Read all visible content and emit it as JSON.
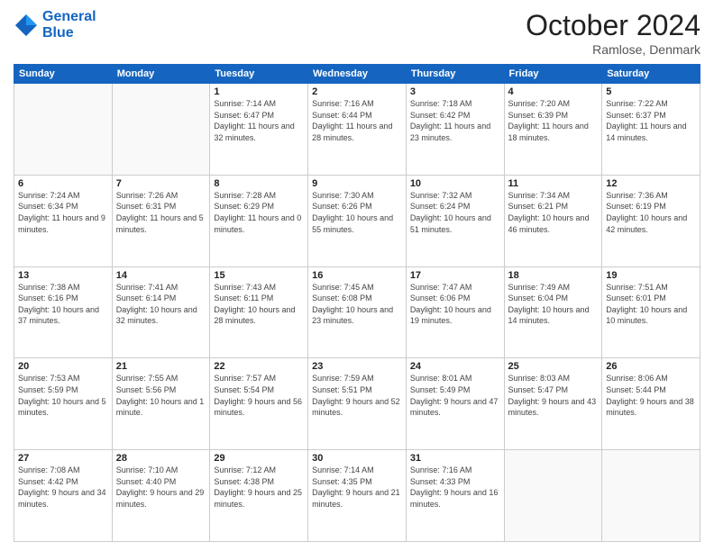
{
  "header": {
    "logo_line1": "General",
    "logo_line2": "Blue",
    "month": "October 2024",
    "location": "Ramlose, Denmark"
  },
  "weekdays": [
    "Sunday",
    "Monday",
    "Tuesday",
    "Wednesday",
    "Thursday",
    "Friday",
    "Saturday"
  ],
  "weeks": [
    [
      {
        "day": "",
        "sunrise": "",
        "sunset": "",
        "daylight": ""
      },
      {
        "day": "",
        "sunrise": "",
        "sunset": "",
        "daylight": ""
      },
      {
        "day": "1",
        "sunrise": "Sunrise: 7:14 AM",
        "sunset": "Sunset: 6:47 PM",
        "daylight": "Daylight: 11 hours and 32 minutes."
      },
      {
        "day": "2",
        "sunrise": "Sunrise: 7:16 AM",
        "sunset": "Sunset: 6:44 PM",
        "daylight": "Daylight: 11 hours and 28 minutes."
      },
      {
        "day": "3",
        "sunrise": "Sunrise: 7:18 AM",
        "sunset": "Sunset: 6:42 PM",
        "daylight": "Daylight: 11 hours and 23 minutes."
      },
      {
        "day": "4",
        "sunrise": "Sunrise: 7:20 AM",
        "sunset": "Sunset: 6:39 PM",
        "daylight": "Daylight: 11 hours and 18 minutes."
      },
      {
        "day": "5",
        "sunrise": "Sunrise: 7:22 AM",
        "sunset": "Sunset: 6:37 PM",
        "daylight": "Daylight: 11 hours and 14 minutes."
      }
    ],
    [
      {
        "day": "6",
        "sunrise": "Sunrise: 7:24 AM",
        "sunset": "Sunset: 6:34 PM",
        "daylight": "Daylight: 11 hours and 9 minutes."
      },
      {
        "day": "7",
        "sunrise": "Sunrise: 7:26 AM",
        "sunset": "Sunset: 6:31 PM",
        "daylight": "Daylight: 11 hours and 5 minutes."
      },
      {
        "day": "8",
        "sunrise": "Sunrise: 7:28 AM",
        "sunset": "Sunset: 6:29 PM",
        "daylight": "Daylight: 11 hours and 0 minutes."
      },
      {
        "day": "9",
        "sunrise": "Sunrise: 7:30 AM",
        "sunset": "Sunset: 6:26 PM",
        "daylight": "Daylight: 10 hours and 55 minutes."
      },
      {
        "day": "10",
        "sunrise": "Sunrise: 7:32 AM",
        "sunset": "Sunset: 6:24 PM",
        "daylight": "Daylight: 10 hours and 51 minutes."
      },
      {
        "day": "11",
        "sunrise": "Sunrise: 7:34 AM",
        "sunset": "Sunset: 6:21 PM",
        "daylight": "Daylight: 10 hours and 46 minutes."
      },
      {
        "day": "12",
        "sunrise": "Sunrise: 7:36 AM",
        "sunset": "Sunset: 6:19 PM",
        "daylight": "Daylight: 10 hours and 42 minutes."
      }
    ],
    [
      {
        "day": "13",
        "sunrise": "Sunrise: 7:38 AM",
        "sunset": "Sunset: 6:16 PM",
        "daylight": "Daylight: 10 hours and 37 minutes."
      },
      {
        "day": "14",
        "sunrise": "Sunrise: 7:41 AM",
        "sunset": "Sunset: 6:14 PM",
        "daylight": "Daylight: 10 hours and 32 minutes."
      },
      {
        "day": "15",
        "sunrise": "Sunrise: 7:43 AM",
        "sunset": "Sunset: 6:11 PM",
        "daylight": "Daylight: 10 hours and 28 minutes."
      },
      {
        "day": "16",
        "sunrise": "Sunrise: 7:45 AM",
        "sunset": "Sunset: 6:08 PM",
        "daylight": "Daylight: 10 hours and 23 minutes."
      },
      {
        "day": "17",
        "sunrise": "Sunrise: 7:47 AM",
        "sunset": "Sunset: 6:06 PM",
        "daylight": "Daylight: 10 hours and 19 minutes."
      },
      {
        "day": "18",
        "sunrise": "Sunrise: 7:49 AM",
        "sunset": "Sunset: 6:04 PM",
        "daylight": "Daylight: 10 hours and 14 minutes."
      },
      {
        "day": "19",
        "sunrise": "Sunrise: 7:51 AM",
        "sunset": "Sunset: 6:01 PM",
        "daylight": "Daylight: 10 hours and 10 minutes."
      }
    ],
    [
      {
        "day": "20",
        "sunrise": "Sunrise: 7:53 AM",
        "sunset": "Sunset: 5:59 PM",
        "daylight": "Daylight: 10 hours and 5 minutes."
      },
      {
        "day": "21",
        "sunrise": "Sunrise: 7:55 AM",
        "sunset": "Sunset: 5:56 PM",
        "daylight": "Daylight: 10 hours and 1 minute."
      },
      {
        "day": "22",
        "sunrise": "Sunrise: 7:57 AM",
        "sunset": "Sunset: 5:54 PM",
        "daylight": "Daylight: 9 hours and 56 minutes."
      },
      {
        "day": "23",
        "sunrise": "Sunrise: 7:59 AM",
        "sunset": "Sunset: 5:51 PM",
        "daylight": "Daylight: 9 hours and 52 minutes."
      },
      {
        "day": "24",
        "sunrise": "Sunrise: 8:01 AM",
        "sunset": "Sunset: 5:49 PM",
        "daylight": "Daylight: 9 hours and 47 minutes."
      },
      {
        "day": "25",
        "sunrise": "Sunrise: 8:03 AM",
        "sunset": "Sunset: 5:47 PM",
        "daylight": "Daylight: 9 hours and 43 minutes."
      },
      {
        "day": "26",
        "sunrise": "Sunrise: 8:06 AM",
        "sunset": "Sunset: 5:44 PM",
        "daylight": "Daylight: 9 hours and 38 minutes."
      }
    ],
    [
      {
        "day": "27",
        "sunrise": "Sunrise: 7:08 AM",
        "sunset": "Sunset: 4:42 PM",
        "daylight": "Daylight: 9 hours and 34 minutes."
      },
      {
        "day": "28",
        "sunrise": "Sunrise: 7:10 AM",
        "sunset": "Sunset: 4:40 PM",
        "daylight": "Daylight: 9 hours and 29 minutes."
      },
      {
        "day": "29",
        "sunrise": "Sunrise: 7:12 AM",
        "sunset": "Sunset: 4:38 PM",
        "daylight": "Daylight: 9 hours and 25 minutes."
      },
      {
        "day": "30",
        "sunrise": "Sunrise: 7:14 AM",
        "sunset": "Sunset: 4:35 PM",
        "daylight": "Daylight: 9 hours and 21 minutes."
      },
      {
        "day": "31",
        "sunrise": "Sunrise: 7:16 AM",
        "sunset": "Sunset: 4:33 PM",
        "daylight": "Daylight: 9 hours and 16 minutes."
      },
      {
        "day": "",
        "sunrise": "",
        "sunset": "",
        "daylight": ""
      },
      {
        "day": "",
        "sunrise": "",
        "sunset": "",
        "daylight": ""
      }
    ]
  ]
}
